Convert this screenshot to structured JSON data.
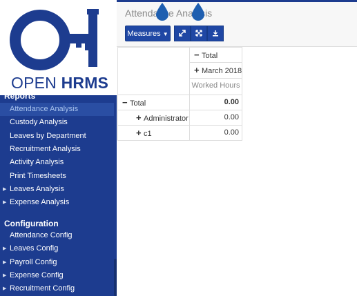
{
  "logo": {
    "brand_light": "OPEN",
    "brand_bold": "HRMS"
  },
  "sidebar": {
    "reports_title": "Reports",
    "reports_items": [
      {
        "label": "Attendance Analysis",
        "active": true,
        "caret": false
      },
      {
        "label": "Custody Analysis",
        "active": false,
        "caret": false
      },
      {
        "label": "Leaves by Department",
        "active": false,
        "caret": false
      },
      {
        "label": "Recruitment Analysis",
        "active": false,
        "caret": false
      },
      {
        "label": "Activity Analysis",
        "active": false,
        "caret": false
      },
      {
        "label": "Print Timesheets",
        "active": false,
        "caret": false
      },
      {
        "label": "Leaves Analysis",
        "active": false,
        "caret": true
      },
      {
        "label": "Expense Analysis",
        "active": false,
        "caret": true
      }
    ],
    "config_title": "Configuration",
    "config_items": [
      {
        "label": "Attendance Config",
        "caret": false
      },
      {
        "label": "Leaves Config",
        "caret": true
      },
      {
        "label": "Payroll Config",
        "caret": true
      },
      {
        "label": "Expense Config",
        "caret": true
      },
      {
        "label": "Recruitment Config",
        "caret": true
      }
    ]
  },
  "control_panel": {
    "title": "Attendance Analysis",
    "measures_label": "Measures"
  },
  "pivot": {
    "col_header_total": "Total",
    "col_header_period": "March 2018",
    "measure_label": "Worked Hours",
    "row_total_label": "Total",
    "row_total_value": "0.00",
    "rows": [
      {
        "label": "Administrator",
        "value": "0.00"
      },
      {
        "label": "c1",
        "value": "0.00"
      }
    ]
  },
  "colors": {
    "brand": "#1d3c8f",
    "button": "#1f47a4",
    "active_menu_text": "#a9c4ee"
  }
}
